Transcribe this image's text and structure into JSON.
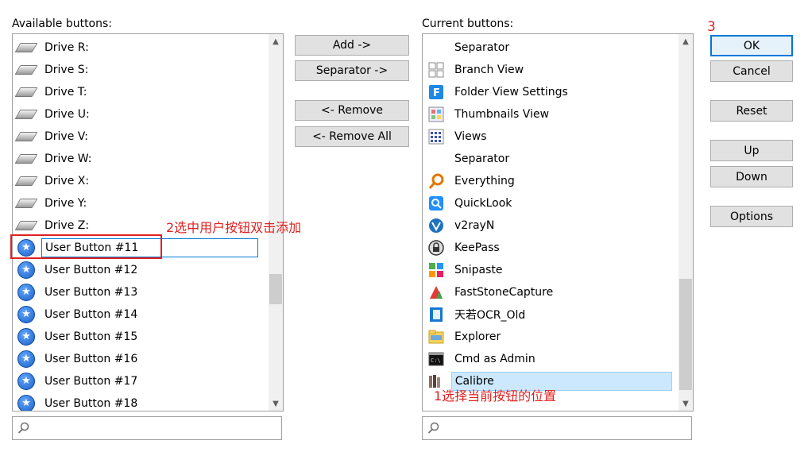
{
  "available_label": "Available buttons:",
  "current_label": "Current buttons:",
  "available_items": [
    {
      "label": "Drive R:",
      "icon": "drive-icon"
    },
    {
      "label": "Drive S:",
      "icon": "drive-icon"
    },
    {
      "label": "Drive T:",
      "icon": "drive-icon"
    },
    {
      "label": "Drive U:",
      "icon": "drive-icon"
    },
    {
      "label": "Drive V:",
      "icon": "drive-icon"
    },
    {
      "label": "Drive W:",
      "icon": "drive-icon"
    },
    {
      "label": "Drive X:",
      "icon": "drive-icon"
    },
    {
      "label": "Drive Y:",
      "icon": "drive-icon"
    },
    {
      "label": "Drive Z:",
      "icon": "drive-icon"
    },
    {
      "label": "User Button #11",
      "icon": "user-button-star-icon"
    },
    {
      "label": "User Button #12",
      "icon": "user-button-star-icon"
    },
    {
      "label": "User Button #13",
      "icon": "user-button-star-icon"
    },
    {
      "label": "User Button #14",
      "icon": "user-button-star-icon"
    },
    {
      "label": "User Button #15",
      "icon": "user-button-star-icon"
    },
    {
      "label": "User Button #16",
      "icon": "user-button-star-icon"
    },
    {
      "label": "User Button #17",
      "icon": "user-button-star-icon"
    },
    {
      "label": "User Button #18",
      "icon": "user-button-star-icon"
    }
  ],
  "current_items": [
    {
      "label": "Separator",
      "icon": "none"
    },
    {
      "label": "Branch View",
      "icon": "branch-view-icon"
    },
    {
      "label": "Folder View Settings",
      "icon": "folder-view-settings-icon"
    },
    {
      "label": "Thumbnails View",
      "icon": "thumbnails-view-icon"
    },
    {
      "label": "Views",
      "icon": "views-icon"
    },
    {
      "label": "Separator",
      "icon": "none"
    },
    {
      "label": "Everything",
      "icon": "everything-icon"
    },
    {
      "label": "QuickLook",
      "icon": "quicklook-icon"
    },
    {
      "label": "v2rayN",
      "icon": "v2rayn-icon"
    },
    {
      "label": "KeePass",
      "icon": "keepass-icon"
    },
    {
      "label": "Snipaste",
      "icon": "snipaste-icon"
    },
    {
      "label": "FastStoneCapture",
      "icon": "faststone-capture-icon"
    },
    {
      "label": "天若OCR_Old",
      "icon": "ocr-icon"
    },
    {
      "label": "Explorer",
      "icon": "explorer-icon"
    },
    {
      "label": "Cmd as Admin",
      "icon": "cmd-icon"
    },
    {
      "label": "Calibre",
      "icon": "calibre-icon"
    }
  ],
  "middle_buttons": {
    "add": "Add ->",
    "separator": "Separator ->",
    "remove": "<- Remove",
    "remove_all": "<- Remove All"
  },
  "right_buttons": {
    "ok": "OK",
    "cancel": "Cancel",
    "reset": "Reset",
    "up": "Up",
    "down": "Down",
    "options": "Options"
  },
  "annotations": {
    "step1": "1选择当前按钮的位置",
    "step2": "2选中用户按钮双击添加",
    "step3": "3"
  },
  "colors": {
    "selection_bg": "#cce8ff",
    "selection_border": "#99d1ff",
    "annotation_red": "#e02020",
    "focus_blue": "#0078d7"
  }
}
